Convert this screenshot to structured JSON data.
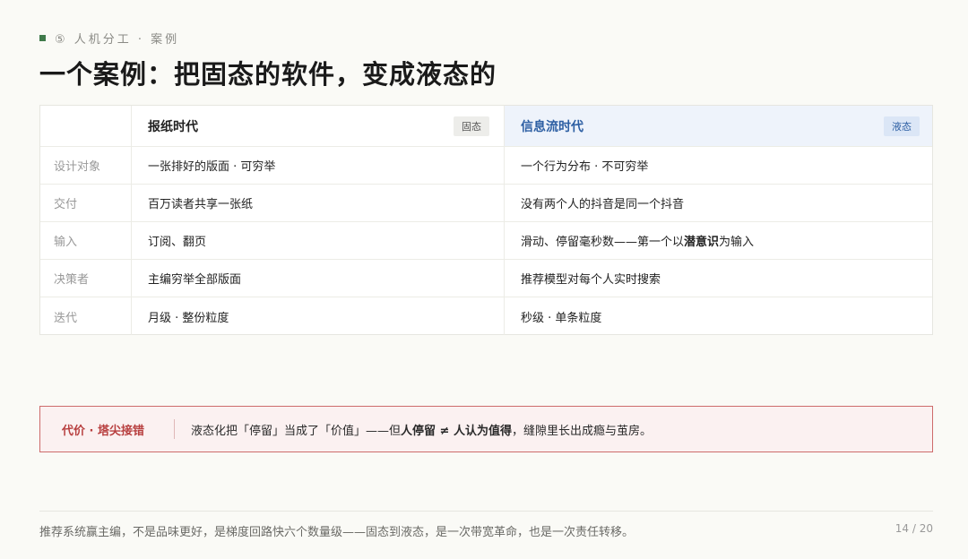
{
  "eyebrow": "⑤ 人机分工 · 案例",
  "title": "一个案例：把固态的软件，变成液态的",
  "table": {
    "head": {
      "col1": "报纸时代",
      "col1_tag": "固态",
      "col2": "信息流时代",
      "col2_tag": "液态"
    },
    "rows": [
      {
        "label": "设计对象",
        "a": "一张排好的版面 · 可穷举",
        "b_pre": "一个行为分布 · 不可穷举",
        "b_bold": "",
        "b_post": ""
      },
      {
        "label": "交付",
        "a": "百万读者共享一张纸",
        "b_pre": "没有两个人的抖音是同一个抖音",
        "b_bold": "",
        "b_post": ""
      },
      {
        "label": "输入",
        "a": "订阅、翻页",
        "b_pre": "滑动、停留毫秒数——第一个以",
        "b_bold": "潜意识",
        "b_post": "为输入"
      },
      {
        "label": "决策者",
        "a": "主编穷举全部版面",
        "b_pre": "推荐模型对每个人实时搜索",
        "b_bold": "",
        "b_post": ""
      },
      {
        "label": "迭代",
        "a": "月级 · 整份粒度",
        "b_pre": "秒级 · 单条粒度",
        "b_bold": "",
        "b_post": ""
      }
    ]
  },
  "callout": {
    "label": "代价 · 塔尖接错",
    "pre": "液态化把「停留」当成了「价值」——但",
    "bold": "人停留 ≠ 人认为值得",
    "post": "，缝隙里长出成瘾与茧房。"
  },
  "footer": "推荐系统赢主编，不是品味更好，是梯度回路快六个数量级——固态到液态，是一次带宽革命，也是一次责任转移。",
  "page_num": "14 / 20",
  "colors": {
    "accent_green": "#3f7a4a",
    "accent_blue": "#2d5fa3",
    "alert_red": "#b84040"
  }
}
